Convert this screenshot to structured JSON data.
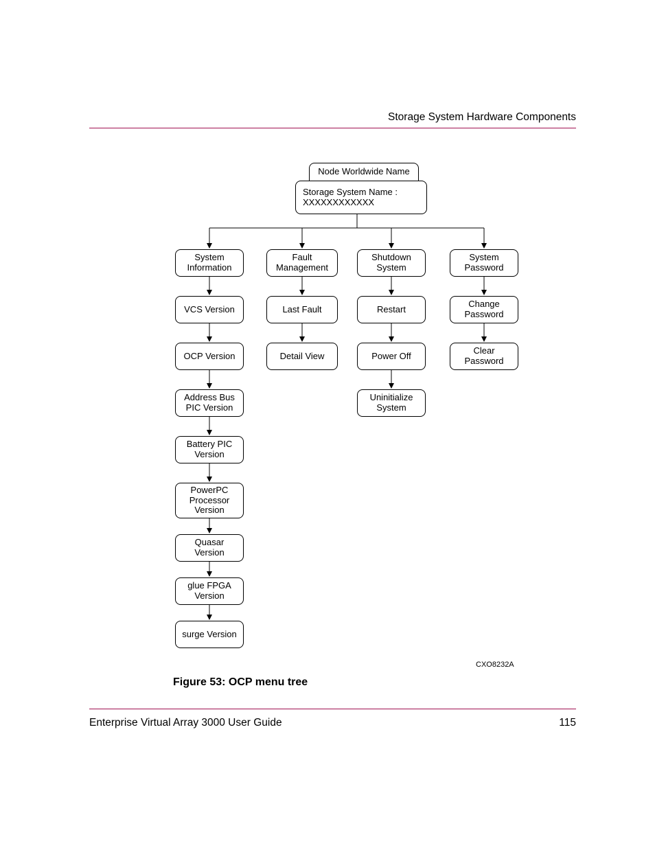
{
  "header": {
    "section_title": "Storage System Hardware Components"
  },
  "footer": {
    "book_title": "Enterprise Virtual Array 3000 User Guide",
    "page_number": "115"
  },
  "figure": {
    "caption": "Figure 53:  OCP menu tree",
    "id": "CXO8232A"
  },
  "diagram": {
    "root_tab": "Node Worldwide Name",
    "root_main": "Storage System Name : XXXXXXXXXXXX",
    "columns": [
      {
        "head": "System Information",
        "items": [
          "VCS Version",
          "OCP Version",
          "Address Bus PIC Version",
          "Battery PIC Version",
          "PowerPC Processor Version",
          "Quasar Version",
          "glue FPGA Version",
          "surge Version"
        ]
      },
      {
        "head": "Fault Management",
        "items": [
          "Last Fault",
          "Detail View"
        ]
      },
      {
        "head": "Shutdown System",
        "items": [
          "Restart",
          "Power Off",
          "Uninitialize System"
        ]
      },
      {
        "head": "System Password",
        "items": [
          "Change Password",
          "Clear Password"
        ]
      }
    ]
  }
}
